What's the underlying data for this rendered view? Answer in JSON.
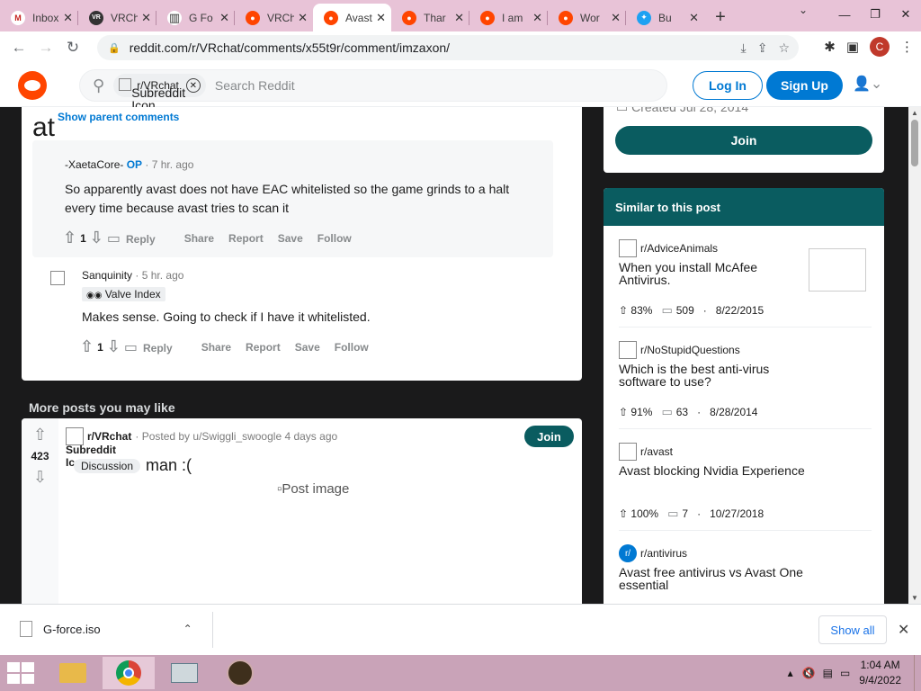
{
  "browser": {
    "tabs": [
      {
        "title": "Inbox",
        "fav_color": "#c5221f",
        "fav": "M"
      },
      {
        "title": "VRChat",
        "fav_color": "#333333",
        "fav": "VR"
      },
      {
        "title": "G Fo",
        "fav_color": "#333333",
        "fav": "▥"
      },
      {
        "title": "VRChat",
        "fav_color": "#ff4500",
        "fav": "●"
      },
      {
        "title": "Avast",
        "fav_color": "#ff4500",
        "fav": "●"
      },
      {
        "title": "Thar",
        "fav_color": "#ff4500",
        "fav": "●"
      },
      {
        "title": "I am",
        "fav_color": "#ff4500",
        "fav": "●"
      },
      {
        "title": "Wor",
        "fav_color": "#ff4500",
        "fav": "●"
      },
      {
        "title": "Bu",
        "fav_color": "#1da1f2",
        "fav": "✦"
      }
    ],
    "url": "reddit.com/r/VRchat/comments/x55t9r/comment/imzaxon/",
    "profile_initial": "C"
  },
  "reddit_header": {
    "chip_label": "r/VRchat",
    "chip_icon_alt": "Subreddit Icon",
    "search_placeholder": "Search Reddit",
    "login_label": "Log In",
    "signup_label": "Sign Up"
  },
  "thread": {
    "partial_text": "at",
    "partial_text2": "'l",
    "show_parent": "Show parent comments",
    "comment1": {
      "author": "-XaetaCore-",
      "op_badge": "OP",
      "time": "· 7 hr. ago",
      "text": "So apparently avast does not have EAC whitelisted so the game grinds to a halt every time because avast tries to scan it",
      "votes": "1"
    },
    "comment2": {
      "author": "Sanquinity",
      "time": "· 5 hr. ago",
      "flair": "Valve Index",
      "text": "Makes sense. Going to check if I have it whitelisted.",
      "votes": "1"
    },
    "actions": {
      "reply": "Reply",
      "share": "Share",
      "report": "Report",
      "save": "Save",
      "follow": "Follow"
    }
  },
  "more_posts": {
    "heading": "More posts you may like",
    "post": {
      "votes": "423",
      "subreddit": "r/VRchat",
      "posted_by": "· Posted by u/Swiggli_swoogle 4 days ago",
      "icon_alt": "Subreddit Icon",
      "flair": "Discussion",
      "title": "man :(",
      "image_alt": "Post image",
      "join": "Join"
    }
  },
  "sidebar": {
    "created": "Created Jul 28, 2014",
    "join": "Join",
    "similar_heading": "Similar to this post",
    "items": [
      {
        "sub": "r/AdviceAnimals",
        "title": "When you install McAfee Antivirus.",
        "pct": "83%",
        "comments": "509",
        "date": "8/22/2015"
      },
      {
        "sub": "r/NoStupidQuestions",
        "title": "Which is the best anti-virus software to use?",
        "pct": "91%",
        "comments": "63",
        "date": "8/28/2014"
      },
      {
        "sub": "r/avast",
        "title": "Avast blocking Nvidia Experience",
        "pct": "100%",
        "comments": "7",
        "date": "10/27/2018"
      },
      {
        "sub": "r/antivirus",
        "title": "Avast free antivirus vs Avast One essential",
        "pct": "",
        "comments": "",
        "date": ""
      }
    ]
  },
  "downloads": {
    "file": "G-force.iso",
    "show_all": "Show all"
  },
  "taskbar": {
    "time": "1:04 AM",
    "date": "9/4/2022"
  }
}
